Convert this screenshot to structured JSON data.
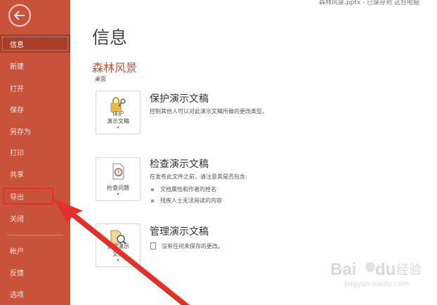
{
  "window": {
    "file_status": "森林风景.pptx - 已保存到 这台电脑"
  },
  "sidebar": {
    "items": [
      {
        "label": "信息",
        "active": true
      },
      {
        "label": "新建"
      },
      {
        "label": "打开"
      },
      {
        "label": "保存"
      },
      {
        "label": "另存为"
      },
      {
        "label": "打印"
      },
      {
        "label": "共享"
      },
      {
        "label": "导出"
      },
      {
        "label": "关闭"
      },
      {
        "label": "帐户"
      },
      {
        "label": "反馈"
      },
      {
        "label": "选项"
      }
    ],
    "back_icon": "arrow-left-circle-icon",
    "color": "#c9523a",
    "active_color": "#a83f2b"
  },
  "main": {
    "title": "信息",
    "doc_name": "森林风景",
    "doc_location": "桌面",
    "sections": [
      {
        "title": "保护演示文稿",
        "tile_label": "保护\n演示文稿",
        "tile_icon": "lock-key-icon",
        "description": "控制其他人可以对此演示文稿所做的更改类型。"
      },
      {
        "title": "检查演示文稿",
        "tile_label": "检查问题",
        "tile_icon": "inspect-document-icon",
        "description": "在发布此文件之前，请注意其是否包含:",
        "bullets": [
          "文档属性和作者的姓名",
          "残疾人士无法阅读的内容"
        ]
      },
      {
        "title": "管理演示文稿",
        "tile_label": "管理演示\n文稿",
        "tile_icon": "manage-document-search-icon",
        "description": "没有任何未保存的更改。"
      }
    ]
  },
  "annotation": {
    "highlight_color": "#e4302b"
  },
  "watermark": {
    "brand": "Bai",
    "brand2": "du",
    "product": "经验",
    "url": "jingyan.baidu.com"
  }
}
